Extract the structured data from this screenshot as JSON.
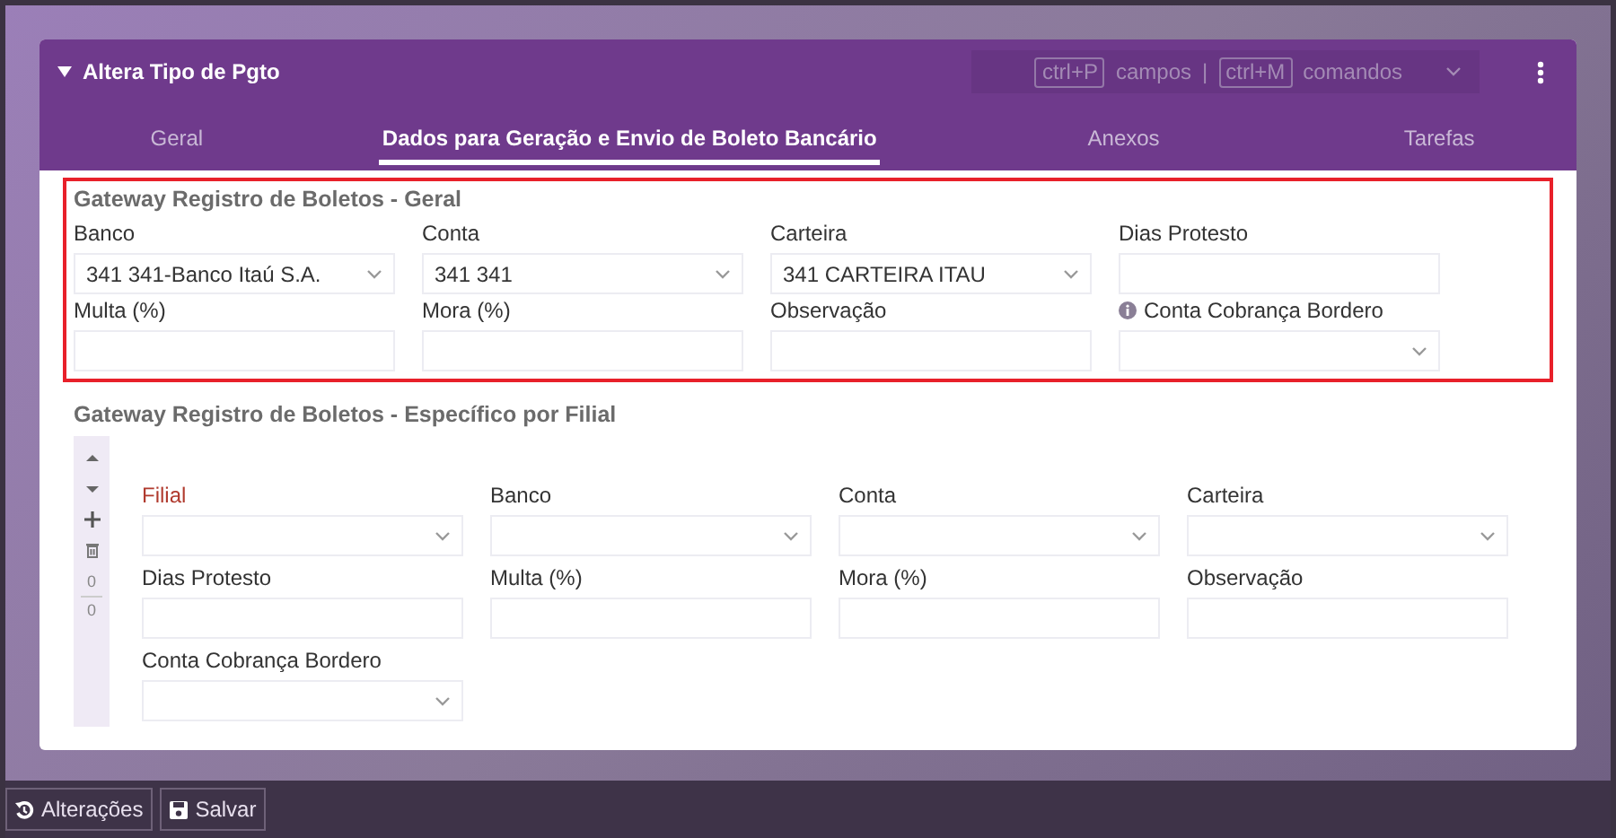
{
  "window": {
    "title": "Altera Tipo de Pgto",
    "expanded": true
  },
  "shortcuts": [
    {
      "key": "ctrl+P",
      "label": "campos"
    },
    {
      "key": "ctrl+M",
      "label": "comandos"
    }
  ],
  "shortcut_separator": "|",
  "tabs": [
    {
      "label": "Geral",
      "selected": false
    },
    {
      "label": "Dados para Geração e Envio de Boleto Bancário",
      "selected": true
    },
    {
      "label": "Anexos",
      "selected": false
    },
    {
      "label": "Tarefas",
      "selected": false
    }
  ],
  "sections": [
    {
      "title": "Gateway Registro de Boletos - Geral",
      "highlighted": true,
      "fields": [
        {
          "label": "Banco",
          "kind": "select",
          "value": "341 341-Banco Itaú S.A.",
          "required": false,
          "info": false
        },
        {
          "label": "Conta",
          "kind": "select",
          "value": "341 341",
          "required": false,
          "info": false
        },
        {
          "label": "Carteira",
          "kind": "select",
          "value": "341 CARTEIRA ITAU",
          "required": false,
          "info": false
        },
        {
          "label": "Dias Protesto",
          "kind": "input",
          "required": false,
          "info": false
        },
        {
          "label": "Multa (%)",
          "kind": "input",
          "required": false,
          "info": false
        },
        {
          "label": "Mora (%)",
          "kind": "input",
          "required": false,
          "info": false
        },
        {
          "label": "Observação",
          "kind": "input",
          "required": false,
          "info": false
        },
        {
          "label": "Conta Cobrança Bordero",
          "kind": "select",
          "required": false,
          "info": true
        }
      ]
    },
    {
      "title": "Gateway Registro de Boletos - Específico por Filial",
      "toolbar": {
        "current": "0",
        "total": "0"
      },
      "fields": [
        {
          "label": "Filial",
          "kind": "select",
          "required": true,
          "info": false
        },
        {
          "label": "Banco",
          "kind": "select",
          "required": false,
          "info": false
        },
        {
          "label": "Conta",
          "kind": "select",
          "required": false,
          "info": false
        },
        {
          "label": "Carteira",
          "kind": "select",
          "required": false,
          "info": false
        },
        {
          "label": "Dias Protesto",
          "kind": "input",
          "required": false,
          "info": false
        },
        {
          "label": "Multa (%)",
          "kind": "input",
          "required": false,
          "info": false
        },
        {
          "label": "Mora (%)",
          "kind": "input",
          "required": false,
          "info": false
        },
        {
          "label": "Observação",
          "kind": "input",
          "required": false,
          "info": false
        },
        {
          "label": "Conta Cobrança Bordero",
          "kind": "select",
          "required": false,
          "info": false
        }
      ]
    }
  ],
  "footer_buttons": [
    {
      "label": "Alterações"
    },
    {
      "label": "Salvar"
    }
  ]
}
